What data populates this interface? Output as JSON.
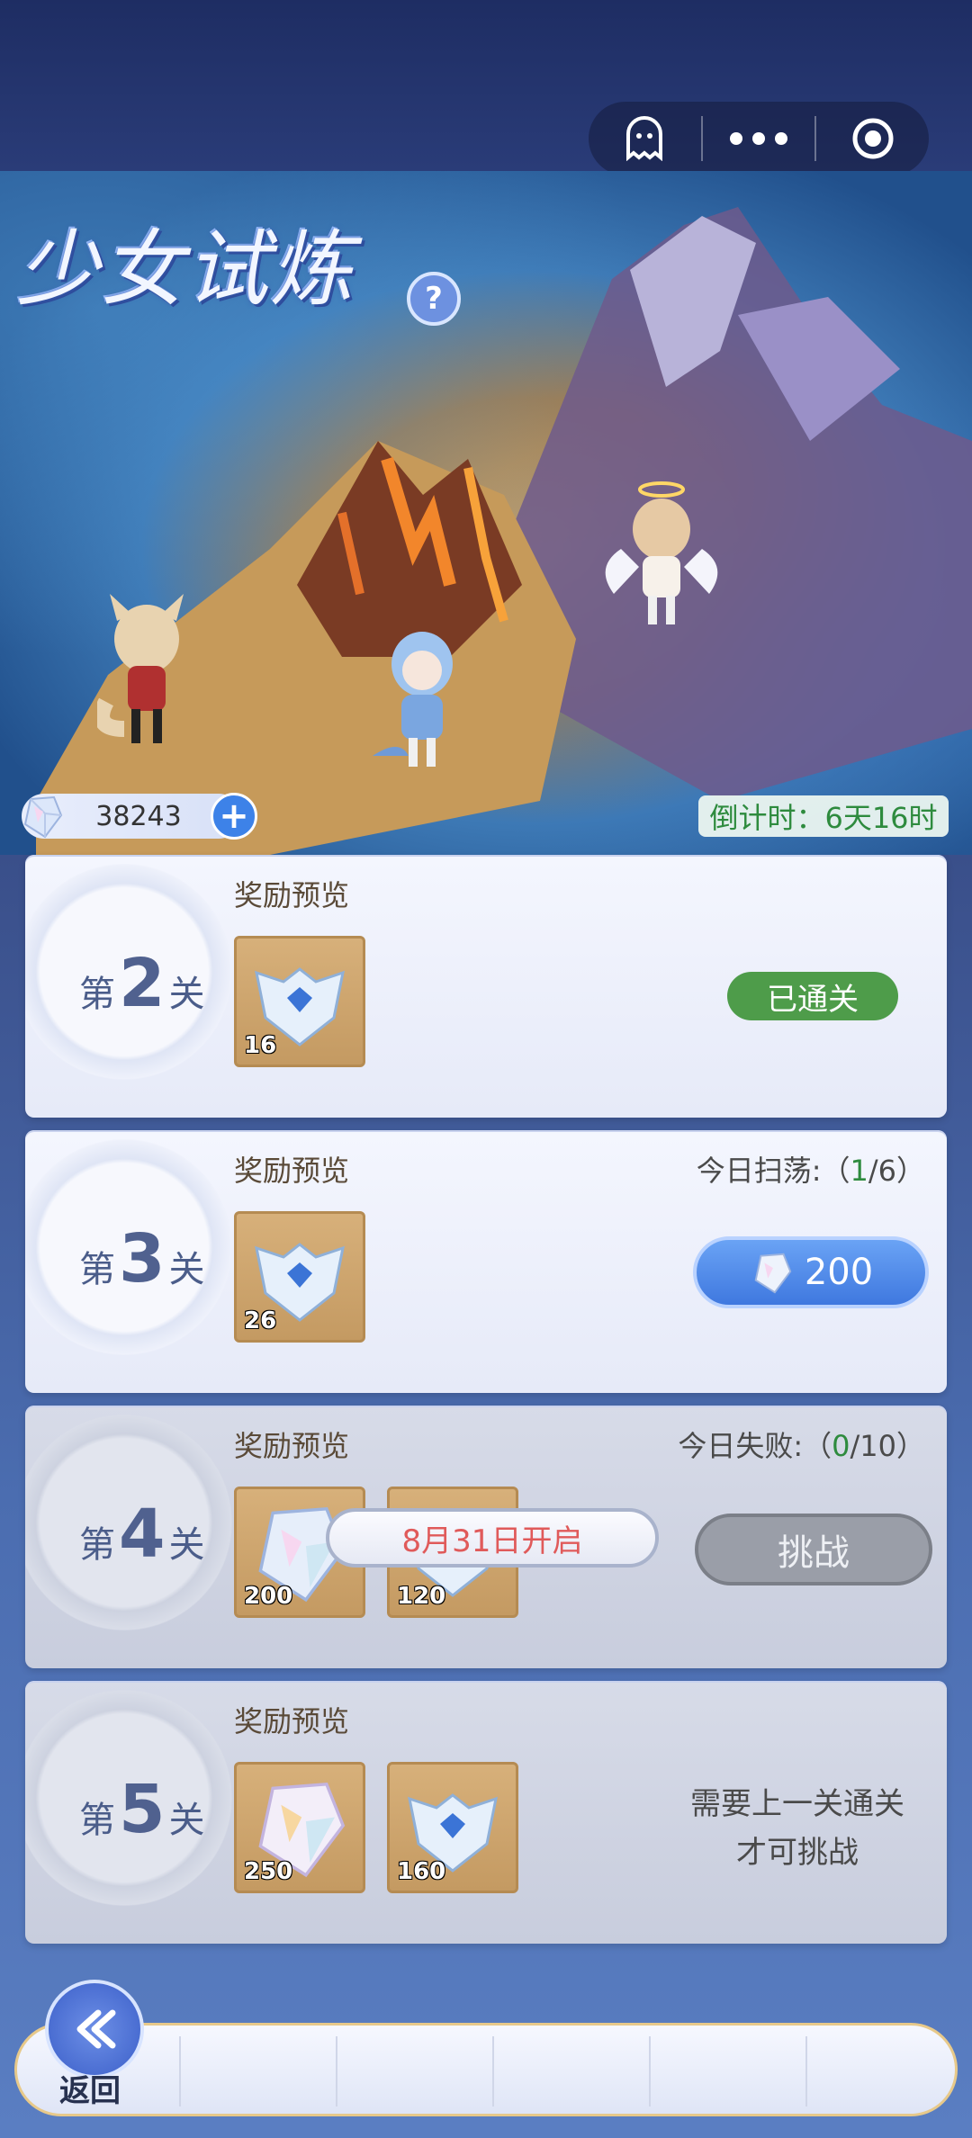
{
  "title": "少女试炼",
  "capsule": {
    "ghost_icon": "ghost-icon",
    "more_icon": "more-icon",
    "close_icon": "target-icon"
  },
  "currency": {
    "value": "38243",
    "icon": "crystal-icon"
  },
  "countdown": "倒计时：6天16时",
  "levels": [
    {
      "prefix": "第",
      "num": "2",
      "suffix": "关",
      "reward_label": "奖励预览",
      "items": [
        {
          "icon": "armor-icon",
          "count": "16"
        }
      ],
      "action": "已通关"
    },
    {
      "prefix": "第",
      "num": "3",
      "suffix": "关",
      "reward_label": "奖励预览",
      "status_prefix": "今日扫荡:（",
      "status_value": "1",
      "status_suffix": "/6）",
      "items": [
        {
          "icon": "armor-icon",
          "count": "26"
        }
      ],
      "action": "200"
    },
    {
      "prefix": "第",
      "num": "4",
      "suffix": "关",
      "reward_label": "奖励预览",
      "status_prefix": "今日失败:（",
      "status_value": "0",
      "status_suffix": "/10）",
      "items": [
        {
          "icon": "crystal-icon",
          "count": "200"
        },
        {
          "icon": "armor-icon",
          "count": "120"
        }
      ],
      "action": "挑战",
      "open_notice": "8月31日开启"
    },
    {
      "prefix": "第",
      "num": "5",
      "suffix": "关",
      "reward_label": "奖励预览",
      "items": [
        {
          "icon": "crystal-icon",
          "count": "250"
        },
        {
          "icon": "armor-icon",
          "count": "160"
        }
      ],
      "requirement_line1": "需要上一关通关",
      "requirement_line2": "才可挑战"
    }
  ],
  "back_label": "返回",
  "colors": {
    "accent_green": "#4e9c4a",
    "accent_blue": "#3f78df",
    "warning_red": "#e05a5a"
  }
}
